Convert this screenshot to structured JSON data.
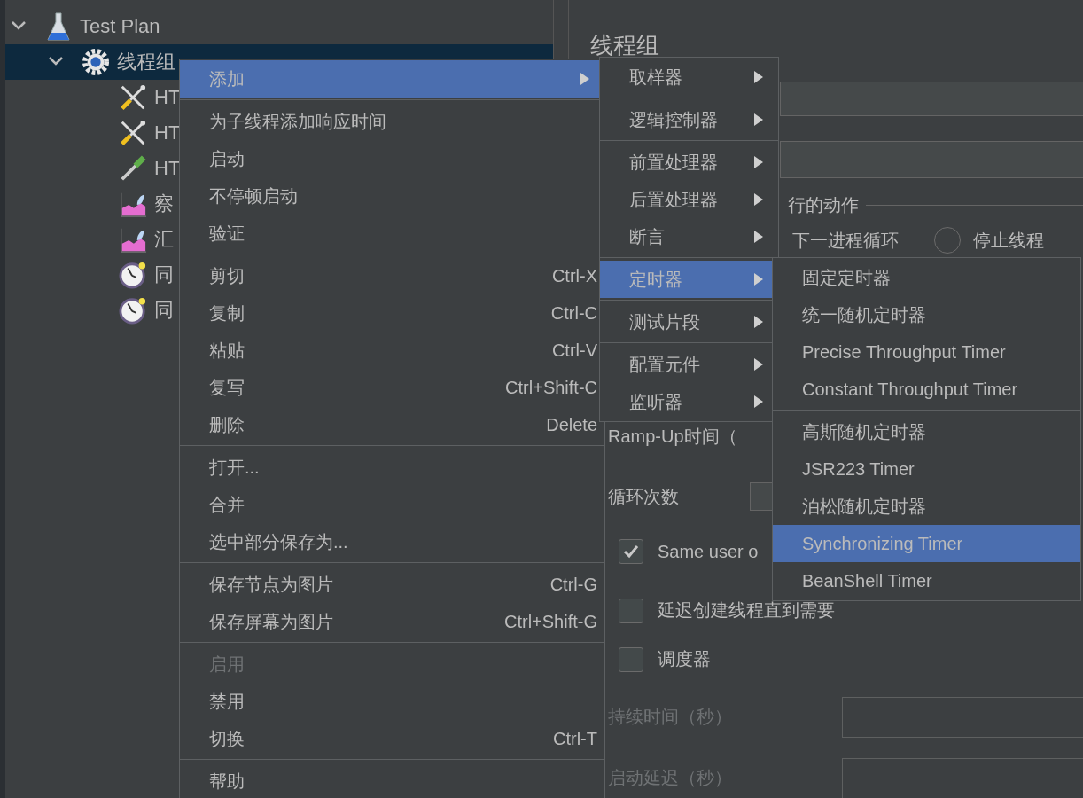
{
  "tree": [
    {
      "label": "Test Plan",
      "kind": "plan",
      "expanded": true,
      "selected": false,
      "children": [
        {
          "label": "线程组",
          "kind": "thread_group",
          "expanded": true,
          "selected": true,
          "children": [
            {
              "label": "HT",
              "kind": "sampler",
              "selected": false
            },
            {
              "label": "HT",
              "kind": "sampler",
              "selected": false
            },
            {
              "label": "HT",
              "kind": "extractor",
              "selected": false
            },
            {
              "label": "察",
              "kind": "listener",
              "selected": false
            },
            {
              "label": "汇",
              "kind": "listener",
              "selected": false
            },
            {
              "label": "同",
              "kind": "timer",
              "selected": false
            },
            {
              "label": "同",
              "kind": "timer",
              "selected": false
            }
          ]
        }
      ]
    }
  ],
  "panel": {
    "title": "线程组",
    "action_group_label": "行的动作",
    "action_text": "下一进程循环",
    "radio": {
      "label": "停止线程",
      "selected": false
    },
    "ramp_up_label": "Ramp-Up时间（",
    "loop_label": "循环次数",
    "checkboxes": [
      {
        "label": "Same user o",
        "checked": true
      },
      {
        "label": "延迟创建线程直到需要",
        "checked": false
      },
      {
        "label": "调度器",
        "checked": false
      }
    ],
    "fields": [
      {
        "label": "持续时间（秒）",
        "disabled": true
      },
      {
        "label": "启动延迟（秒）",
        "disabled": true
      }
    ]
  },
  "menus": [
    {
      "groups": [
        [
          {
            "label": "添加",
            "selected": true,
            "disabled": false,
            "has_submenu": true
          }
        ],
        [
          {
            "label": "为子线程添加响应时间",
            "selected": false,
            "disabled": false,
            "has_submenu": false
          },
          {
            "label": "启动",
            "selected": false,
            "disabled": false,
            "has_submenu": false
          },
          {
            "label": "不停顿启动",
            "selected": false,
            "disabled": false,
            "has_submenu": false
          },
          {
            "label": "验证",
            "selected": false,
            "disabled": false,
            "has_submenu": false
          }
        ],
        [
          {
            "label": "剪切",
            "shortcut": "Ctrl-X",
            "selected": false,
            "disabled": false,
            "has_submenu": false
          },
          {
            "label": "复制",
            "shortcut": "Ctrl-C",
            "selected": false,
            "disabled": false,
            "has_submenu": false
          },
          {
            "label": "粘贴",
            "shortcut": "Ctrl-V",
            "selected": false,
            "disabled": false,
            "has_submenu": false
          },
          {
            "label": "复写",
            "shortcut": "Ctrl+Shift-C",
            "selected": false,
            "disabled": false,
            "has_submenu": false
          },
          {
            "label": "删除",
            "shortcut": "Delete",
            "selected": false,
            "disabled": false,
            "has_submenu": false
          }
        ],
        [
          {
            "label": "打开...",
            "selected": false,
            "disabled": false,
            "has_submenu": false
          },
          {
            "label": "合并",
            "selected": false,
            "disabled": false,
            "has_submenu": false
          },
          {
            "label": "选中部分保存为...",
            "selected": false,
            "disabled": false,
            "has_submenu": false
          }
        ],
        [
          {
            "label": "保存节点为图片",
            "shortcut": "Ctrl-G",
            "selected": false,
            "disabled": false,
            "has_submenu": false
          },
          {
            "label": "保存屏幕为图片",
            "shortcut": "Ctrl+Shift-G",
            "selected": false,
            "disabled": false,
            "has_submenu": false
          }
        ],
        [
          {
            "label": "启用",
            "selected": false,
            "disabled": true,
            "has_submenu": false
          },
          {
            "label": "禁用",
            "selected": false,
            "disabled": false,
            "has_submenu": false
          },
          {
            "label": "切换",
            "shortcut": "Ctrl-T",
            "selected": false,
            "disabled": false,
            "has_submenu": false
          }
        ],
        [
          {
            "label": "帮助",
            "selected": false,
            "disabled": false,
            "has_submenu": false
          }
        ]
      ]
    },
    {
      "groups": [
        [
          {
            "label": "取样器",
            "selected": false,
            "has_submenu": true
          }
        ],
        [
          {
            "label": "逻辑控制器",
            "selected": false,
            "has_submenu": true
          }
        ],
        [
          {
            "label": "前置处理器",
            "selected": false,
            "has_submenu": true
          },
          {
            "label": "后置处理器",
            "selected": false,
            "has_submenu": true
          },
          {
            "label": "断言",
            "selected": false,
            "has_submenu": true
          }
        ],
        [
          {
            "label": "定时器",
            "selected": true,
            "has_submenu": true
          }
        ],
        [
          {
            "label": "测试片段",
            "selected": false,
            "has_submenu": true
          }
        ],
        [
          {
            "label": "配置元件",
            "selected": false,
            "has_submenu": true
          },
          {
            "label": "监听器",
            "selected": false,
            "has_submenu": true
          }
        ]
      ]
    },
    {
      "groups": [
        [
          {
            "label": "固定定时器",
            "selected": false,
            "has_submenu": false
          },
          {
            "label": "统一随机定时器",
            "selected": false,
            "has_submenu": false
          },
          {
            "label": "Precise Throughput Timer",
            "selected": false,
            "has_submenu": false
          },
          {
            "label": "Constant Throughput Timer",
            "selected": false,
            "has_submenu": false
          }
        ],
        [
          {
            "label": "高斯随机定时器",
            "selected": false,
            "has_submenu": false
          },
          {
            "label": "JSR223 Timer",
            "selected": false,
            "has_submenu": false
          },
          {
            "label": "泊松随机定时器",
            "selected": false,
            "has_submenu": false
          },
          {
            "label": "Synchronizing Timer",
            "selected": true,
            "has_submenu": false
          },
          {
            "label": "BeanShell Timer",
            "selected": false,
            "has_submenu": false
          }
        ]
      ]
    }
  ]
}
